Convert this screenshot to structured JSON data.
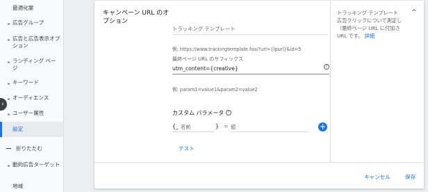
{
  "sidebar": {
    "items": [
      {
        "label": "最適化案",
        "caret": false
      },
      {
        "label": "広告グループ",
        "caret": true
      },
      {
        "label": "広告と広告表示オプション",
        "caret": true
      },
      {
        "label": "ランディング ページ",
        "caret": true
      },
      {
        "label": "キーワード",
        "caret": true
      },
      {
        "label": "オーディエンス",
        "caret": true
      },
      {
        "label": "ユーザー属性",
        "caret": true
      },
      {
        "label": "設定",
        "caret": false,
        "selected": true
      },
      {
        "label": "動的広告ターゲット",
        "caret": true
      },
      {
        "label": "地域",
        "caret": false
      }
    ],
    "collapse_label": "折りたたむ",
    "collapse_toggle": "‹"
  },
  "section": {
    "title": "キャンペーン URL のオプション",
    "tracking_template_placeholder": "トラッキング テンプレート",
    "tracking_template_example": "例: https://www.trackingtemplate.foo/?url={lpurl}&id=5",
    "final_url_suffix_label": "最終ページ URL のサフィックス",
    "final_url_suffix_value": "utm_content={creative}",
    "final_url_suffix_example": "例: param1=value1&param2=value2",
    "custom_params_title": "カスタム パラメータ",
    "param_open_brace": "{_",
    "param_name_placeholder": "名前",
    "param_close_brace": "}",
    "param_equals": "=",
    "param_value_placeholder": "値",
    "test_link": "テスト",
    "help_glyph": "?",
    "add_glyph": "+"
  },
  "right_panel": {
    "text": "トラッキング テンプレート 広告クリックについて測定し（最終ページ URL に付加さ URL です。",
    "link": "詳細",
    "collapse_glyph": "^"
  },
  "footer": {
    "cancel_label": "キャンセル",
    "save_label": "保存"
  },
  "colors": {
    "accent": "#1a73e8",
    "sidebar_bg": "#f8f9fa",
    "page_bg": "#eceff1"
  }
}
